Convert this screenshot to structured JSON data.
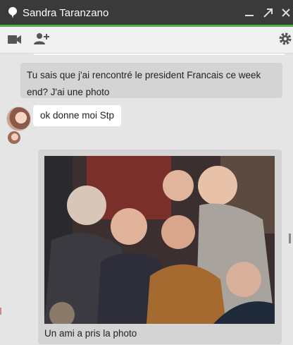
{
  "window": {
    "title": "Sandra Taranzano",
    "controls": [
      "minimize-icon",
      "popout-icon",
      "close-icon"
    ]
  },
  "toolbar": {
    "left_icons": [
      "video-call-icon",
      "add-person-icon"
    ],
    "right_icons": [
      "settings-gear-icon"
    ]
  },
  "messages": [
    {
      "direction": "outgoing",
      "text": "Tu sais que j'ai rencontré le president Francais ce week end? J'ai une photo"
    },
    {
      "direction": "incoming",
      "text": "ok donne moi Stp"
    }
  ],
  "photo_message": {
    "caption": "Un ami a pris la photo"
  },
  "colors": {
    "titlebar": "#3a3a3a",
    "accent": "#4caf50",
    "chat_bg": "#e5e5e5",
    "outgoing_bubble": "#d4d4d4",
    "incoming_bubble": "#ffffff"
  }
}
